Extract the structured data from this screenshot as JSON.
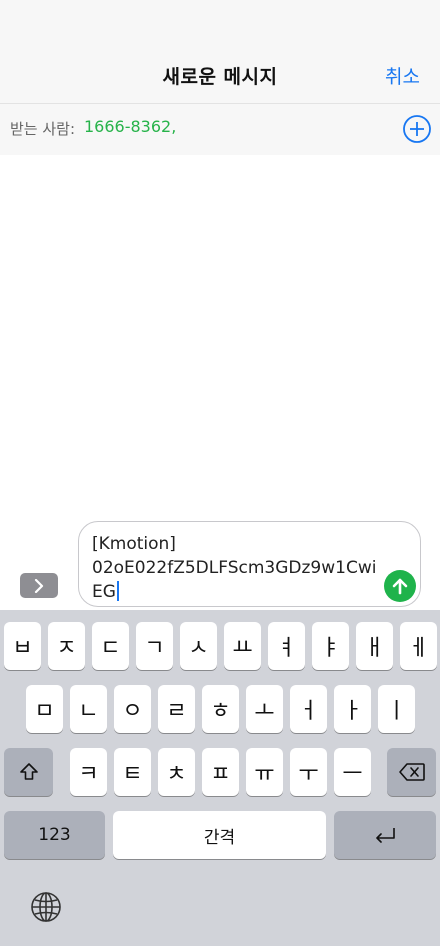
{
  "header": {
    "title": "새로운 메시지",
    "cancel_label": "취소"
  },
  "recipient": {
    "label": "받는 사람:",
    "value": "1666-8362,"
  },
  "composer": {
    "text": "[Kmotion]\n02oE022fZ5DLFScm3GDz9w1Cwi\nEG"
  },
  "keyboard": {
    "row1": [
      "ㅂ",
      "ㅈ",
      "ㄷ",
      "ㄱ",
      "ㅅ",
      "ㅛ",
      "ㅕ",
      "ㅑ",
      "ㅐ",
      "ㅔ"
    ],
    "row2": [
      "ㅁ",
      "ㄴ",
      "ㅇ",
      "ㄹ",
      "ㅎ",
      "ㅗ",
      "ㅓ",
      "ㅏ",
      "ㅣ"
    ],
    "row3": [
      "ㅋ",
      "ㅌ",
      "ㅊ",
      "ㅍ",
      "ㅠ",
      "ㅜ",
      "ㅡ"
    ],
    "numbers_label": "123",
    "space_label": "간격"
  },
  "colors": {
    "accent": "#1877f2",
    "recipient": "#27b34a",
    "send": "#1fb34b"
  }
}
